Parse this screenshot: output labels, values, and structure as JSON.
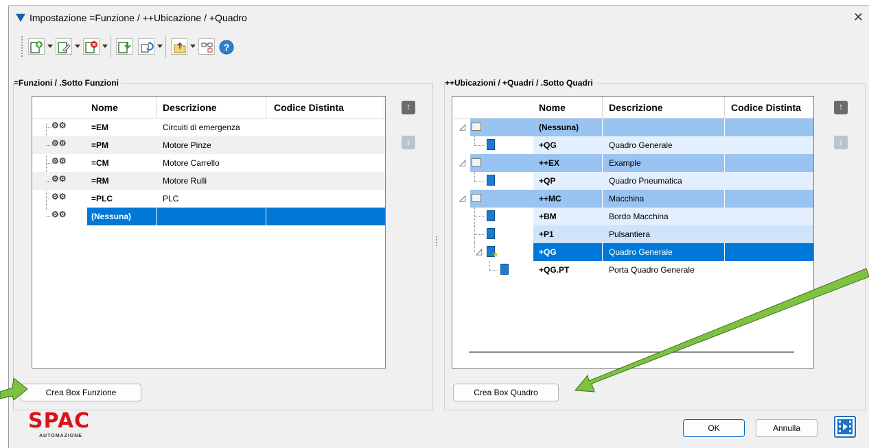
{
  "window": {
    "title": "Impostazione =Funzione / ++Ubicazione / +Quadro",
    "close_glyph": "✕"
  },
  "toolbar": {
    "icons": [
      "add-function-icon",
      "edit-icon",
      "delete-icon",
      "import-icon",
      "refresh-icon",
      "folder-up-icon",
      "tree-structure-icon",
      "help-icon"
    ]
  },
  "left_panel": {
    "title": "=Funzioni / .Sotto Funzioni",
    "columns": [
      "Nome",
      "Descrizione",
      "Codice Distinta"
    ],
    "rows": [
      {
        "nome": "=EM",
        "descrizione": "Circuiti di emergenza",
        "codice": ""
      },
      {
        "nome": "=PM",
        "descrizione": "Motore Pinze",
        "codice": ""
      },
      {
        "nome": "=CM",
        "descrizione": "Motore Carrello",
        "codice": ""
      },
      {
        "nome": "=RM",
        "descrizione": "Motore Rulli",
        "codice": ""
      },
      {
        "nome": "=PLC",
        "descrizione": "PLC",
        "codice": ""
      },
      {
        "nome": "(Nessuna)",
        "descrizione": "",
        "codice": ""
      }
    ],
    "button": "Crea Box Funzione"
  },
  "right_panel": {
    "title": "++Ubicazioni / +Quadri / .Sotto Quadri",
    "columns": [
      "Nome",
      "Descrizione",
      "Codice Distinta"
    ],
    "rows": [
      {
        "nome": "(Nessuna)",
        "descrizione": "",
        "codice": ""
      },
      {
        "nome": "+QG",
        "descrizione": "Quadro Generale",
        "codice": ""
      },
      {
        "nome": "++EX",
        "descrizione": "Example",
        "codice": ""
      },
      {
        "nome": "+QP",
        "descrizione": "Quadro Pneumatica",
        "codice": ""
      },
      {
        "nome": "++MC",
        "descrizione": "Macchina",
        "codice": ""
      },
      {
        "nome": "+BM",
        "descrizione": "Bordo Macchina",
        "codice": ""
      },
      {
        "nome": "+P1",
        "descrizione": "Pulsantiera",
        "codice": ""
      },
      {
        "nome": "+QG",
        "descrizione": "Quadro Generale",
        "codice": ""
      },
      {
        "nome": "+QG.PT",
        "descrizione": "Porta Quadro Generale",
        "codice": ""
      }
    ],
    "button": "Crea Box Quadro"
  },
  "footer": {
    "logo_text": "SPAC",
    "logo_sub": "AUTOMAZIONE",
    "ok": "OK",
    "cancel": "Annulla"
  },
  "colors": {
    "selected": "#0078d7",
    "group_header": "#99c3f0",
    "light_row": "#e3efff",
    "arrow_active": "#6b6b6b",
    "arrow_disabled": "#b8c4d0",
    "annotation_arrow": "#7ec242"
  }
}
